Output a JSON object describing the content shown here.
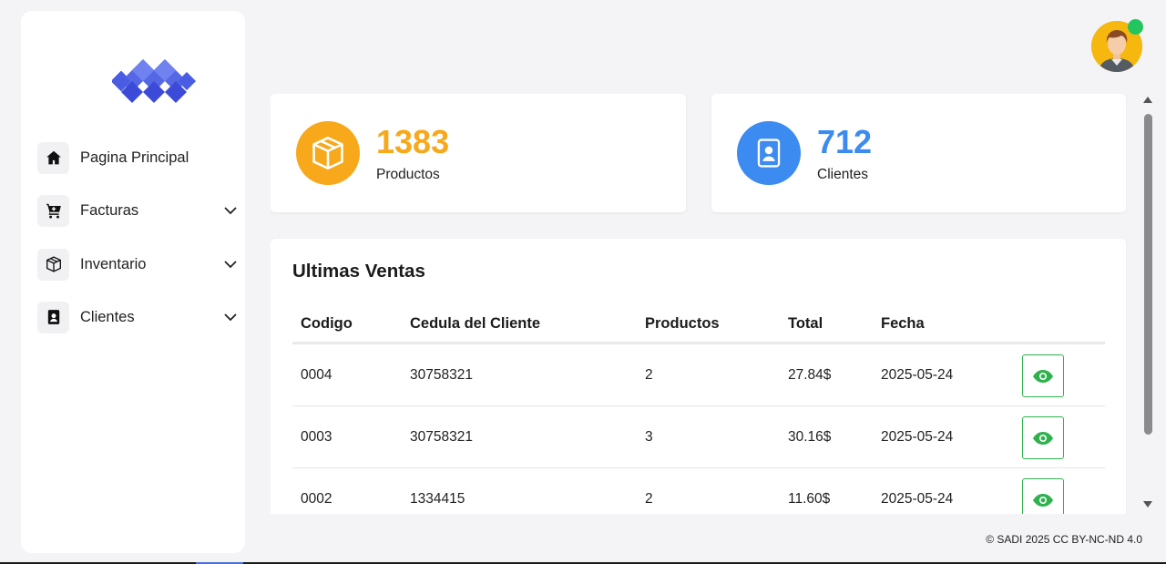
{
  "sidebar": {
    "items": [
      {
        "label": "Pagina Principal",
        "icon": "home-icon",
        "has_submenu": false
      },
      {
        "label": "Facturas",
        "icon": "cart-plus-icon",
        "has_submenu": true
      },
      {
        "label": "Inventario",
        "icon": "box-icon",
        "has_submenu": true
      },
      {
        "label": "Clientes",
        "icon": "person-badge-icon",
        "has_submenu": true
      }
    ]
  },
  "header": {
    "avatar": "user-avatar-icon",
    "status": "online"
  },
  "stats": [
    {
      "value": "1383",
      "label": "Productos",
      "icon": "box-icon",
      "color": "#f7a81b"
    },
    {
      "value": "712",
      "label": "Clientes",
      "icon": "person-badge-icon",
      "color": "#3b8bf0"
    }
  ],
  "sales": {
    "title": "Ultimas Ventas",
    "columns": [
      "Codigo",
      "Cedula del Cliente",
      "Productos",
      "Total",
      "Fecha"
    ],
    "rows": [
      {
        "codigo": "0004",
        "cedula": "30758321",
        "productos": "2",
        "total": "27.84$",
        "fecha": "2025-05-24"
      },
      {
        "codigo": "0003",
        "cedula": "30758321",
        "productos": "3",
        "total": "30.16$",
        "fecha": "2025-05-24"
      },
      {
        "codigo": "0002",
        "cedula": "1334415",
        "productos": "2",
        "total": "11.60$",
        "fecha": "2025-05-24"
      }
    ],
    "action_icon": "eye-icon"
  },
  "footer": {
    "text": "© SADI 2025 CC BY-NC-ND 4.0"
  },
  "colors": {
    "logo": "#4f63e8",
    "accent_green": "#2fb24e",
    "background": "#f4f4f6"
  }
}
